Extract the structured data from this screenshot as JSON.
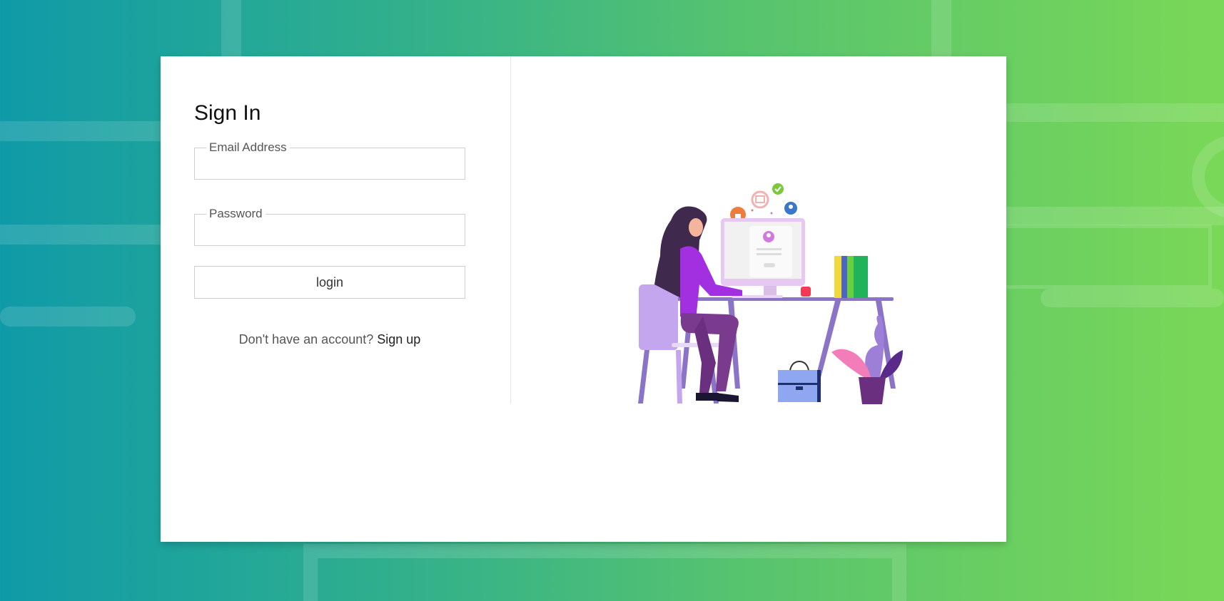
{
  "signin": {
    "title": "Sign In",
    "email_label": "Email Address",
    "email_value": "",
    "password_label": "Password",
    "password_value": "",
    "login_label": "login",
    "no_account_text": "Don't have an account?",
    "signup_link": "Sign up"
  },
  "illustration": {
    "icon": "woman-at-desk-illustration"
  },
  "colors": {
    "gradient_start": "#0f9aa8",
    "gradient_end": "#7ad857",
    "card_bg": "#ffffff",
    "accent_purple": "#a22fe0"
  }
}
